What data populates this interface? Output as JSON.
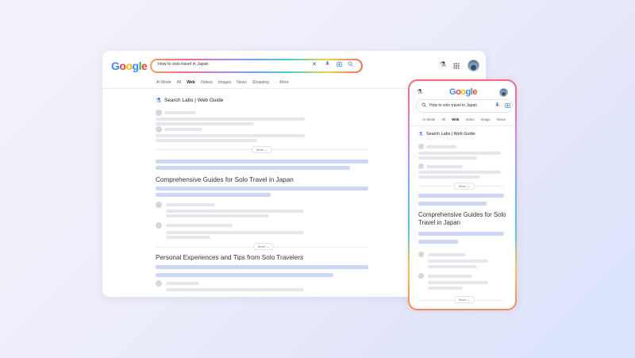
{
  "desktop": {
    "logo": "Google",
    "search_query": "How to solo travel in Japan",
    "tabs": [
      "AI Mode",
      "All",
      "Web",
      "Videos",
      "Images",
      "News",
      "Shopping",
      "⋮ More"
    ],
    "active_tab": "Web",
    "web_guide_title": "Search Labs | Web Guide",
    "more_label": "More ⌄",
    "heading_1": "Comprehensive Guides for Solo Travel in Japan",
    "more_label_2": "More ⌄",
    "heading_2": "Personal Experiences and Tips from Solo Travelers"
  },
  "mobile": {
    "logo": "Google",
    "search_query": "How to solo travel in Japan",
    "tabs": [
      "AI Mode",
      "All",
      "Web",
      "Video",
      "Image",
      "News"
    ],
    "active_tab": "Web",
    "web_guide_title": "Search Labs | Web Guide",
    "more_label": "More ⌄",
    "heading_1": "Comprehensive Guides for Solo Travel in Japan",
    "more_label_2": "More ⌄"
  },
  "icons": {
    "clear": "close-icon",
    "voice": "mic-icon",
    "lens": "camera-icon",
    "search": "search-icon",
    "labs": "flask-icon",
    "apps": "apps-grid-icon"
  },
  "colors": {
    "google_blue": "#4285F4",
    "google_red": "#EA4335",
    "google_yellow": "#FBBC05",
    "google_green": "#34A853",
    "result_bar": "#cdd6f5"
  }
}
